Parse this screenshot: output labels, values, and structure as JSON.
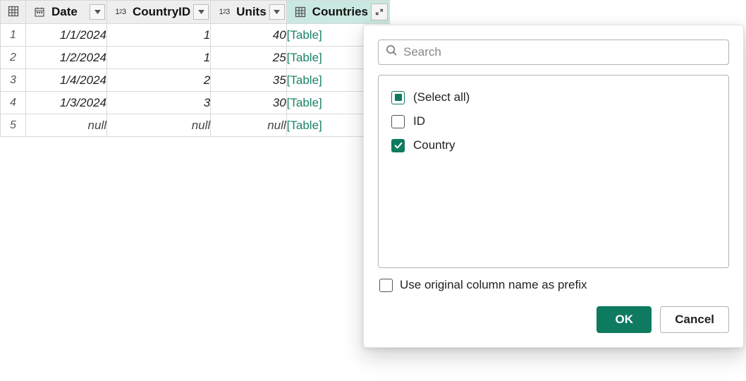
{
  "columns": {
    "date": "Date",
    "countryId": "CountryID",
    "units": "Units",
    "countries": "Countries"
  },
  "rows": [
    {
      "idx": "1",
      "date": "1/1/2024",
      "cid": "1",
      "units": "40",
      "countries": "[Table]"
    },
    {
      "idx": "2",
      "date": "1/2/2024",
      "cid": "1",
      "units": "25",
      "countries": "[Table]"
    },
    {
      "idx": "3",
      "date": "1/4/2024",
      "cid": "2",
      "units": "35",
      "countries": "[Table]"
    },
    {
      "idx": "4",
      "date": "1/3/2024",
      "cid": "3",
      "units": "30",
      "countries": "[Table]"
    },
    {
      "idx": "5",
      "date": "null",
      "cid": "null",
      "units": "null",
      "countries": "[Table]"
    }
  ],
  "popup": {
    "searchPlaceholder": "Search",
    "selectAll": "(Select all)",
    "optId": "ID",
    "optCountry": "Country",
    "prefixLabel": "Use original column name as prefix",
    "okLabel": "OK",
    "cancelLabel": "Cancel"
  }
}
